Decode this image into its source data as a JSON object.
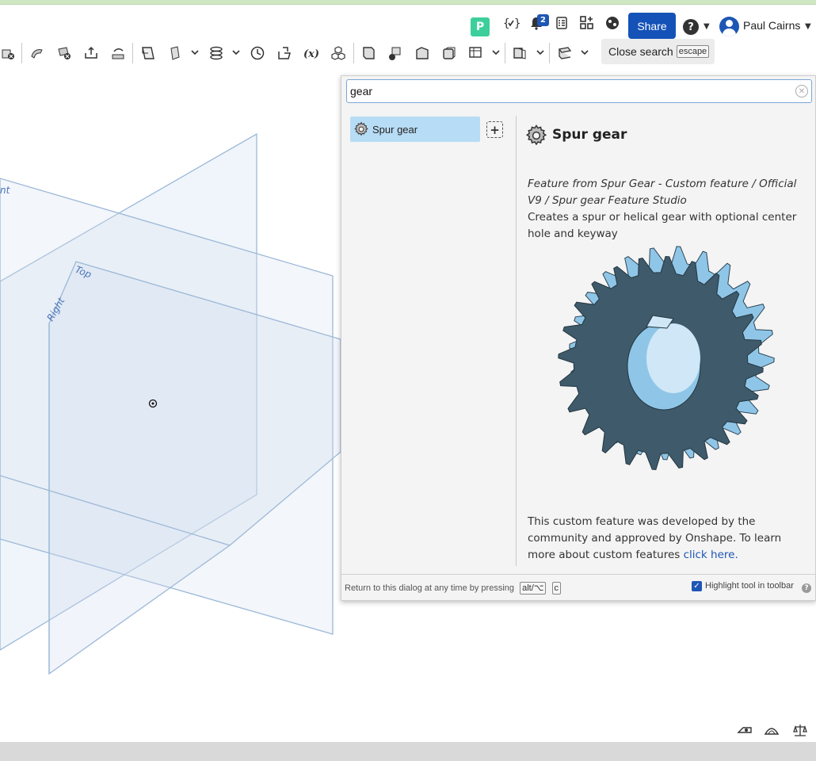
{
  "header": {
    "workspace_badge": "P",
    "notification_count": "2",
    "share_label": "Share",
    "help_label": "?",
    "user_name": "Paul Cairns"
  },
  "toolbar": {
    "close_search_label": "Close search",
    "close_search_key": "escape"
  },
  "viewport": {
    "plane_labels": [
      "nt",
      "Top",
      "Right"
    ]
  },
  "search_panel": {
    "query": "gear",
    "results": [
      {
        "label": "Spur gear",
        "icon": "gear-icon"
      }
    ],
    "detail": {
      "title": "Spur gear",
      "source": "Feature from Spur Gear - Custom feature / Official V9 / Spur gear Feature Studio",
      "description": "Creates a spur or helical gear with optional center hole and keyway",
      "footer_text": "This custom feature was developed by the community and approved by Onshape. To learn more about custom features ",
      "footer_link": "click here."
    },
    "bottom": {
      "return_text": "Return to this dialog at any time by pressing",
      "key1": "alt/⌥",
      "key2": "c",
      "highlight_label": "Highlight tool in toolbar",
      "highlight_checked": true
    }
  },
  "colors": {
    "accent": "#1452b8",
    "selection": "#b7dcf5",
    "gear_dark": "#3e5a6b",
    "gear_light": "#8fc6e8"
  }
}
